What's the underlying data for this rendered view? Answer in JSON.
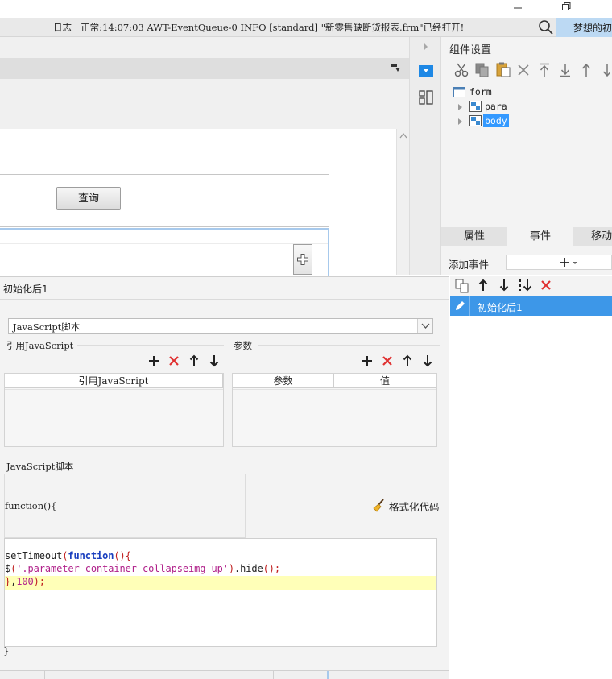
{
  "statusbar": {
    "text": "日志 | 正常:14:07:03 AWT-EventQueue-0 INFO [standard] \"新零售缺断货报表.frm\"已经打开!",
    "user_label": "梦想的初"
  },
  "design": {
    "query_button": "查询"
  },
  "component_panel": {
    "title": "组件设置",
    "tree": [
      {
        "label": "form",
        "level": 0,
        "selected": false
      },
      {
        "label": "para",
        "level": 1,
        "selected": false
      },
      {
        "label": "body",
        "level": 1,
        "selected": true
      }
    ],
    "tabs": [
      "属性",
      "事件",
      "移动"
    ],
    "active_tab": "事件",
    "add_event_label": "添加事件"
  },
  "dialog": {
    "title": "初始化后1",
    "script_type": "JavaScript脚本",
    "ref_group_label": "引用JavaScript",
    "ref_table_header": "引用JavaScript",
    "param_group_label": "参数",
    "param_headers": [
      "参数",
      "值"
    ],
    "script_group_label": "JavaScript脚本",
    "function_open": "function(){",
    "format_label": "格式化代码",
    "function_close": "}",
    "code_lines": [
      "setTimeout(function(){",
      "$('.parameter-container-collapseimg-up').hide();",
      "},100);"
    ]
  },
  "events": {
    "items": [
      "初始化后1"
    ],
    "selected": "初始化后1"
  },
  "colors": {
    "accent": "#3d97e8",
    "selection_blue": "#3399ff",
    "delete_red": "#e03030",
    "highlight_line": "#ffffb8"
  }
}
